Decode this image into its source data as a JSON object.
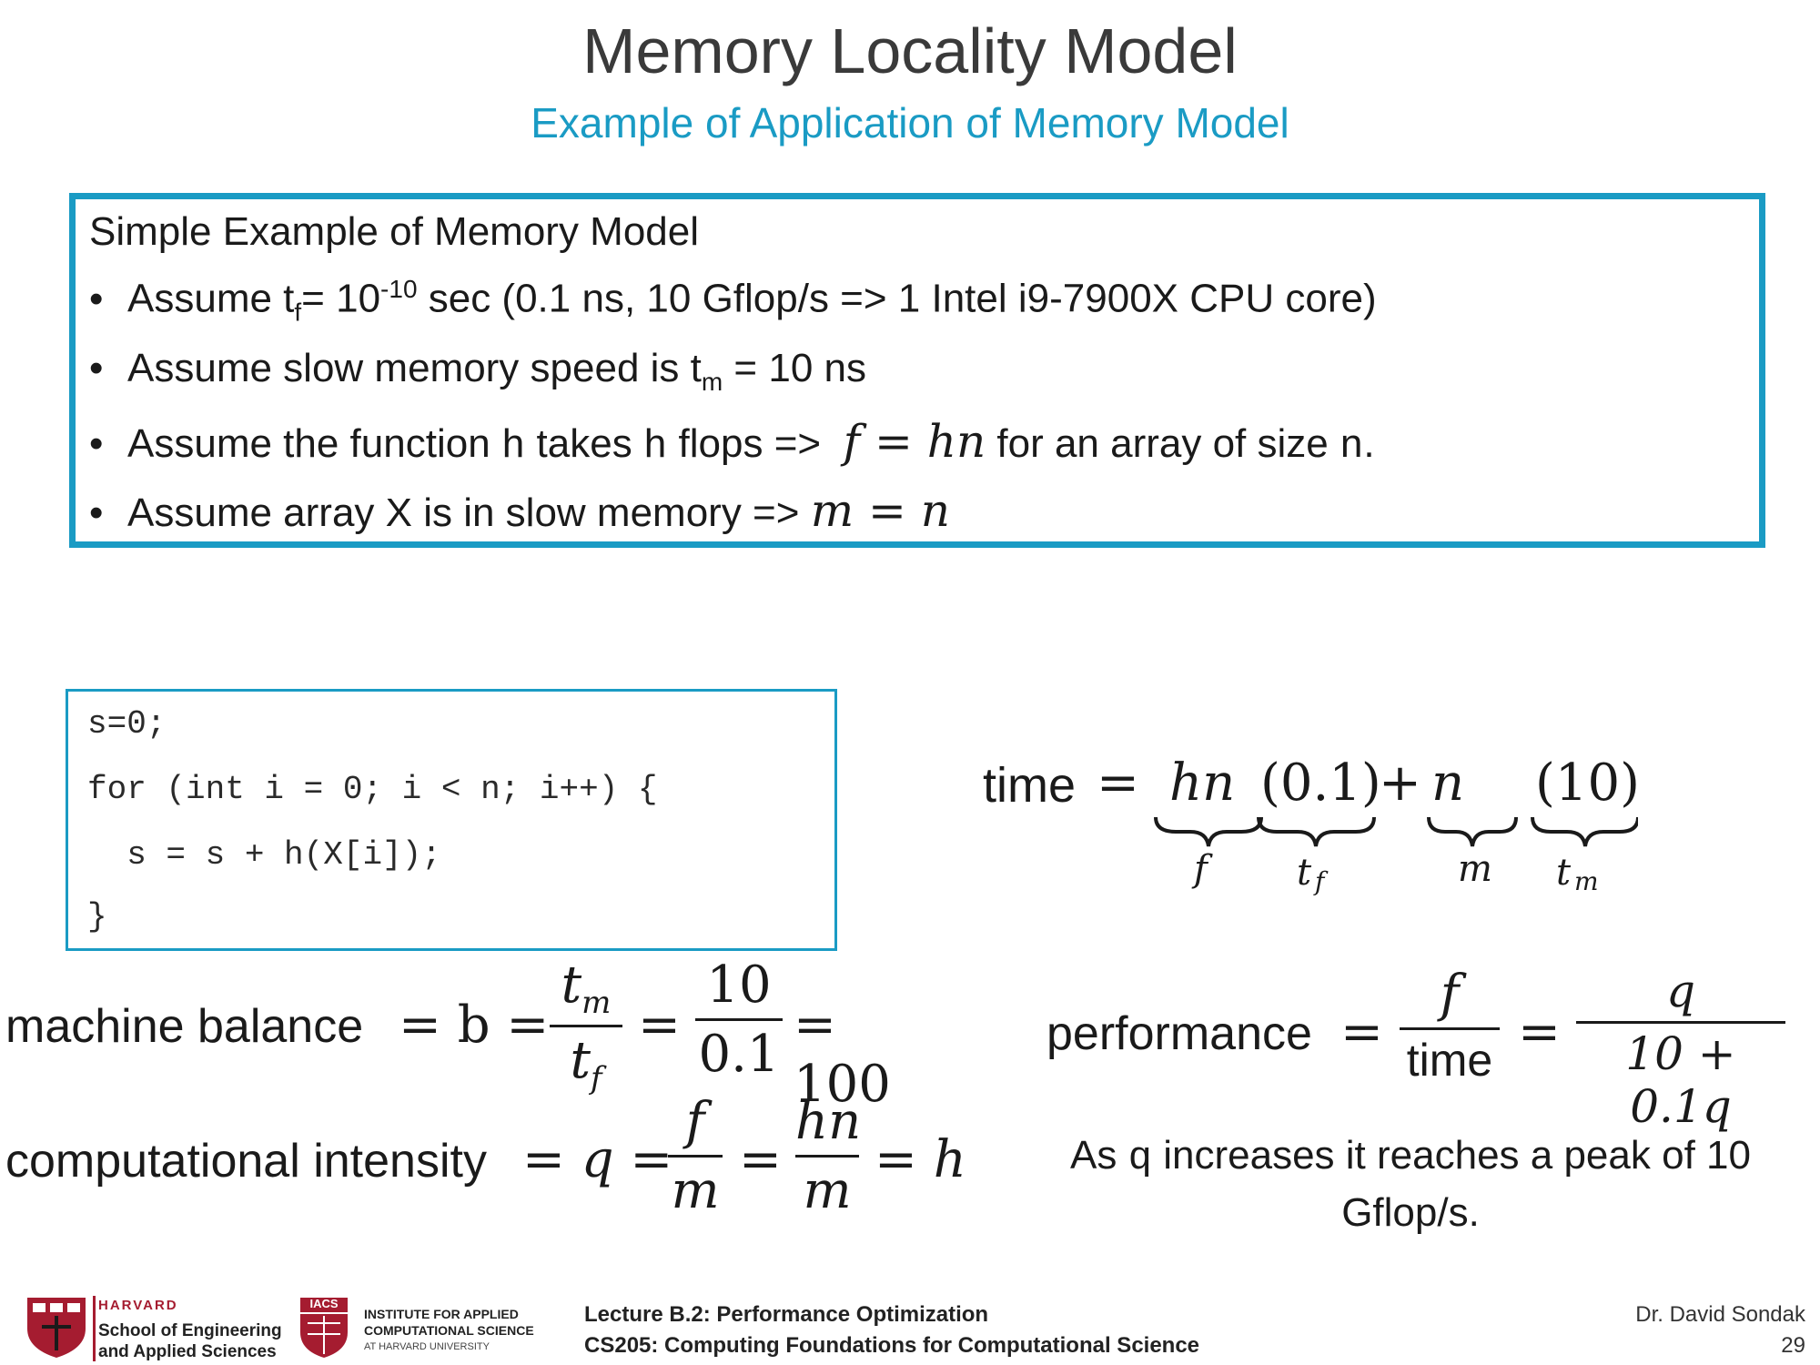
{
  "slide": {
    "title": "Memory Locality Model",
    "subtitle": "Example of Application of Memory Model"
  },
  "assumptions": {
    "heading": "Simple Example of Memory Model",
    "b1": {
      "pre": "Assume t",
      "sub": "f",
      "mid": "= 10",
      "sup": "-10",
      "post": " sec (0.1 ns, 10 Gflop/s => 1 Intel i9-7900X CPU core)"
    },
    "b2": {
      "pre": "Assume slow memory speed is t",
      "sub": "m",
      "post": " = 10 ns"
    },
    "b3": {
      "pre": "Assume the function ",
      "code1": "h",
      "mid1": " takes ",
      "code2": "h",
      "mid2": " flops =>",
      "math": "f = hn",
      "mid3": " for an array of size ",
      "code3": "n",
      "post": "."
    },
    "b4": {
      "pre": "Assume array X is in slow memory =>",
      "math": "m = n"
    },
    "bullet": "•"
  },
  "code": {
    "lines": [
      "s=0;",
      "for (int i = 0; i < n; i++) {",
      "  s = s + h(X[i]);",
      "}"
    ]
  },
  "time_eq": {
    "lhs": "time",
    "eq": "=",
    "t1": "hn",
    "t2": "(0.1)",
    "plus": "+",
    "t3": "n",
    "t4": "(10)",
    "u1": "f",
    "u2": "t",
    "u2sub": "f",
    "u3": "m",
    "u4": "t",
    "u4sub": "m"
  },
  "balance_eq": {
    "label": "machine balance",
    "eq": "= b =",
    "num1": "t",
    "num1sub": "m",
    "den1": "t",
    "den1sub": "f",
    "eq2": "=",
    "num2": "10",
    "den2": "0.1",
    "result": "= 100"
  },
  "intensity_eq": {
    "label": "computational intensity",
    "eq": "= q =",
    "num1": "f",
    "den1": "m",
    "eq2": "=",
    "num2": "hn",
    "den2": "m",
    "result": "= h"
  },
  "performance_eq": {
    "label": "performance",
    "eq": "=",
    "num1": "f",
    "den1": "time",
    "eq2": "=",
    "num2": "q",
    "den2": "10 + 0.1q"
  },
  "note": {
    "pre": "As ",
    "code": "q",
    "post": " increases it reaches a peak of 10",
    "line2": "Gflop/s."
  },
  "footer": {
    "harvard_top": "HARVARD",
    "harvard_l1": "School of Engineering",
    "harvard_l2": "and Applied Sciences",
    "iacs_tag": "IACS",
    "iacs_l1": "INSTITUTE FOR APPLIED",
    "iacs_l2": "COMPUTATIONAL SCIENCE",
    "iacs_l3": "AT HARVARD UNIVERSITY",
    "lecture": "Lecture B.2: Performance Optimization",
    "course": "CS205: Computing Foundations for Computational Science",
    "author": "Dr. David Sondak",
    "page": "29"
  },
  "colors": {
    "accent": "#1a9bc4",
    "harvard_red": "#a51c30"
  }
}
